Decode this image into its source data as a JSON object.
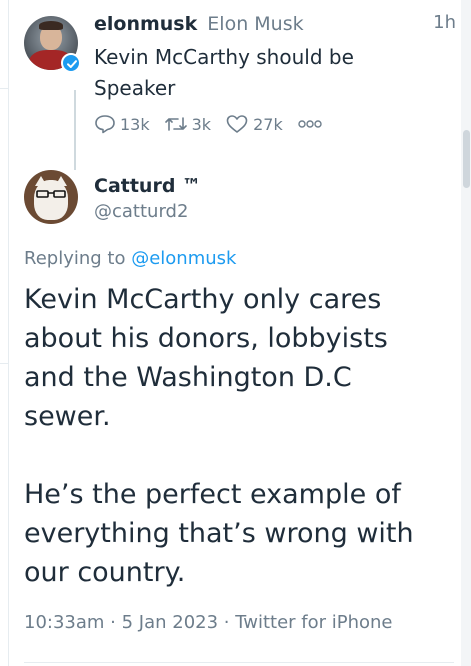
{
  "parent_tweet": {
    "username": "elonmusk",
    "display_name": "Elon Musk",
    "time": "1h",
    "text": "Kevin McCarthy should be Speaker",
    "replies": "13k",
    "retweets": "3k",
    "likes": "27k",
    "verified": true
  },
  "reply_tweet": {
    "name": "Catturd ™",
    "handle": "@catturd2",
    "replying_to_prefix": "Replying to",
    "replying_to_handle": "@elonmusk",
    "paragraphs": [
      "Kevin McCarthy only cares about his donors, lobbyists and the Washington D.C sewer.",
      "He’s the perfect example of everything that’s wrong with our country."
    ],
    "timestamp": "10:33am · 5 Jan 2023 · Twitter for iPhone"
  },
  "colors": {
    "text": "#1f2d3a",
    "muted": "#6d7d8b",
    "link": "#1d9bf0",
    "border": "#e6ecf0"
  },
  "icons": [
    "reply-icon",
    "retweet-icon",
    "like-icon",
    "more-icon",
    "verified-icon"
  ]
}
